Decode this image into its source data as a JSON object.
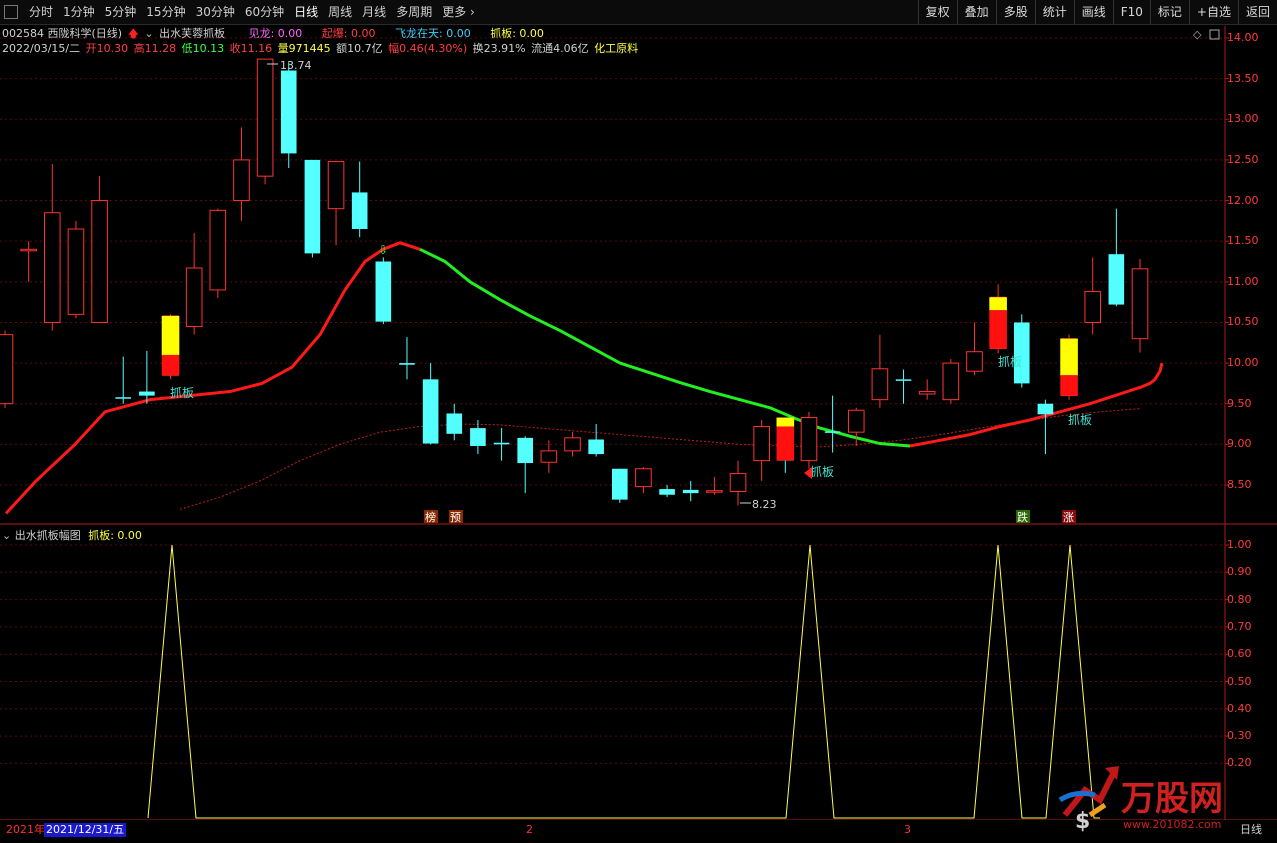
{
  "toolbar": {
    "periods": [
      "分时",
      "1分钟",
      "5分钟",
      "15分钟",
      "30分钟",
      "60分钟",
      "日线",
      "周线",
      "月线",
      "多周期",
      "更多 ›"
    ],
    "active_period": "日线",
    "buttons": [
      "复权",
      "叠加",
      "多股",
      "统计",
      "画线",
      "F10",
      "标记",
      "+自选",
      "返回"
    ]
  },
  "stock": {
    "code_name": "002584 西陇科学(日线)",
    "indicator_name": "出水芙蓉抓板",
    "jianlong": "见龙: 0.00",
    "qibao": "起爆: 0.00",
    "feilong": "飞龙在天: 0.00",
    "zhuaban": "抓板: 0.00"
  },
  "quote": {
    "date": "2022/03/15/二",
    "open": "开10.30",
    "high": "高11.28",
    "low": "低10.13",
    "close": "收11.16",
    "volume": "量971445",
    "amount": "额10.7亿",
    "change": "幅0.46(4.30%)",
    "turnover": "换23.91%",
    "float": "流通4.06亿",
    "sector": "化工原料"
  },
  "sub_panel": {
    "title": "出水抓板幅图",
    "value": "抓板: 0.00"
  },
  "main_axis": [
    "14.00",
    "13.50",
    "13.00",
    "12.50",
    "12.00",
    "11.50",
    "11.00",
    "10.50",
    "10.00",
    "9.50",
    "9.00",
    "8.50"
  ],
  "sub_axis": [
    "1.00",
    "0.90",
    "0.80",
    "0.70",
    "0.60",
    "0.50",
    "0.40",
    "0.30",
    "0.20"
  ],
  "annotations": {
    "high_label": "13.74",
    "low_label": "8.23",
    "signal": "抓板",
    "bang": "榜",
    "yu": "预",
    "die": "跌",
    "zhang": "涨"
  },
  "timeline": {
    "year": "2021年",
    "date_cursor": "2021/12/31/五",
    "month2": "2",
    "month3": "3",
    "right_label": "日线"
  },
  "logo": {
    "text": "万股网",
    "url": "www.201082.com"
  },
  "chart_data": {
    "type": "candlestick",
    "ylim": [
      8.1,
      14.1
    ],
    "candles": [
      {
        "o": 9.5,
        "c": 10.35,
        "h": 10.4,
        "l": 9.45
      },
      {
        "o": 11.4,
        "c": 11.4,
        "h": 11.5,
        "l": 11.0
      },
      {
        "o": 10.5,
        "c": 11.85,
        "h": 12.45,
        "l": 10.4
      },
      {
        "o": 10.6,
        "c": 11.65,
        "h": 11.75,
        "l": 10.55
      },
      {
        "o": 10.5,
        "c": 12.0,
        "h": 12.3,
        "l": 10.5
      },
      {
        "o": 9.58,
        "c": 9.57,
        "h": 10.08,
        "l": 9.5
      },
      {
        "o": 9.65,
        "c": 9.6,
        "h": 10.15,
        "l": 9.5
      },
      {
        "o": 9.85,
        "c": 10.58,
        "h": 10.6,
        "l": 9.8
      },
      {
        "o": 10.45,
        "c": 11.17,
        "h": 11.6,
        "l": 10.35
      },
      {
        "o": 10.9,
        "c": 11.88,
        "h": 11.9,
        "l": 10.8
      },
      {
        "o": 12.0,
        "c": 12.5,
        "h": 12.9,
        "l": 11.75
      },
      {
        "o": 12.3,
        "c": 13.74,
        "h": 13.74,
        "l": 12.2
      },
      {
        "o": 13.6,
        "c": 12.58,
        "h": 13.7,
        "l": 12.4
      },
      {
        "o": 12.5,
        "c": 11.35,
        "h": 12.5,
        "l": 11.3
      },
      {
        "o": 11.9,
        "c": 12.48,
        "h": 12.48,
        "l": 11.45
      },
      {
        "o": 12.1,
        "c": 11.65,
        "h": 12.48,
        "l": 11.55
      },
      {
        "o": 11.25,
        "c": 10.51,
        "h": 11.3,
        "l": 10.48
      },
      {
        "o": 10.0,
        "c": 9.98,
        "h": 10.32,
        "l": 9.8
      },
      {
        "o": 9.8,
        "c": 9.01,
        "h": 10.0,
        "l": 9.0
      },
      {
        "o": 9.38,
        "c": 9.13,
        "h": 9.5,
        "l": 9.05
      },
      {
        "o": 9.2,
        "c": 8.98,
        "h": 9.3,
        "l": 8.88
      },
      {
        "o": 9.02,
        "c": 9.0,
        "h": 9.2,
        "l": 8.8
      },
      {
        "o": 9.08,
        "c": 8.77,
        "h": 9.1,
        "l": 8.4
      },
      {
        "o": 8.78,
        "c": 8.92,
        "h": 9.05,
        "l": 8.65
      },
      {
        "o": 8.92,
        "c": 9.08,
        "h": 9.15,
        "l": 8.85
      },
      {
        "o": 9.06,
        "c": 8.88,
        "h": 9.25,
        "l": 8.85
      },
      {
        "o": 8.7,
        "c": 8.32,
        "h": 8.7,
        "l": 8.28
      },
      {
        "o": 8.48,
        "c": 8.7,
        "h": 8.72,
        "l": 8.4
      },
      {
        "o": 8.45,
        "c": 8.38,
        "h": 8.5,
        "l": 8.35
      },
      {
        "o": 8.44,
        "c": 8.4,
        "h": 8.55,
        "l": 8.3
      },
      {
        "o": 8.42,
        "c": 8.43,
        "h": 8.6,
        "l": 8.38
      },
      {
        "o": 8.42,
        "c": 8.64,
        "h": 8.8,
        "l": 8.25
      },
      {
        "o": 8.8,
        "c": 9.22,
        "h": 9.3,
        "l": 8.55
      },
      {
        "o": 8.95,
        "c": 8.8,
        "h": 9.0,
        "l": 8.65
      },
      {
        "o": 8.8,
        "c": 9.33,
        "h": 9.4,
        "l": 8.7
      },
      {
        "o": 9.16,
        "c": 9.15,
        "h": 9.6,
        "l": 8.9
      },
      {
        "o": 9.15,
        "c": 9.42,
        "h": 9.45,
        "l": 8.98
      },
      {
        "o": 9.55,
        "c": 9.93,
        "h": 10.35,
        "l": 9.45
      },
      {
        "o": 9.8,
        "c": 9.79,
        "h": 9.92,
        "l": 9.5
      },
      {
        "o": 9.62,
        "c": 9.65,
        "h": 9.8,
        "l": 9.55
      },
      {
        "o": 9.55,
        "c": 10.0,
        "h": 10.05,
        "l": 9.5
      },
      {
        "o": 9.9,
        "c": 10.14,
        "h": 10.5,
        "l": 9.85
      },
      {
        "o": 10.18,
        "c": 10.81,
        "h": 10.97,
        "l": 10.12
      },
      {
        "o": 10.5,
        "c": 9.75,
        "h": 10.6,
        "l": 9.7
      },
      {
        "o": 9.5,
        "c": 9.37,
        "h": 9.55,
        "l": 8.88
      },
      {
        "o": 9.6,
        "c": 10.3,
        "h": 10.35,
        "l": 9.55
      },
      {
        "o": 10.5,
        "c": 10.88,
        "h": 11.3,
        "l": 10.35
      },
      {
        "o": 11.34,
        "c": 10.72,
        "h": 11.9,
        "l": 10.7
      },
      {
        "o": 10.3,
        "c": 11.16,
        "h": 11.28,
        "l": 10.13
      }
    ],
    "signal_bars": [
      {
        "index": 7,
        "top": 10.58,
        "mid": 10.1,
        "bottom": 9.85
      },
      {
        "index": 33,
        "top": 9.33,
        "mid": 9.22,
        "bottom": 8.8
      },
      {
        "index": 42,
        "top": 10.81,
        "mid": 10.65,
        "bottom": 10.18
      },
      {
        "index": 45,
        "top": 10.3,
        "mid": 9.85,
        "bottom": 9.6
      }
    ],
    "ma_fast": [
      8.15,
      8.55,
      9.0,
      9.4,
      9.55,
      9.6,
      9.65,
      9.75,
      9.95,
      10.35,
      10.9,
      11.25,
      11.4,
      11.48,
      11.4,
      11.25,
      11.0,
      10.78,
      10.58,
      10.4,
      10.2,
      10.0,
      9.88,
      9.76,
      9.65,
      9.55,
      9.45,
      9.32,
      9.2,
      9.1,
      9.01,
      8.98,
      9.05,
      9.12,
      9.22,
      9.3,
      9.4,
      9.5,
      9.62,
      9.7,
      9.75,
      9.8,
      9.9,
      10.0
    ],
    "ma_fast_x": [
      6,
      36,
      75,
      105,
      150,
      190,
      230,
      262,
      292,
      320,
      345,
      365,
      383,
      400,
      420,
      445,
      470,
      500,
      530,
      560,
      590,
      620,
      650,
      680,
      710,
      740,
      770,
      795,
      820,
      850,
      880,
      910,
      940,
      970,
      1000,
      1030,
      1060,
      1090,
      1120,
      1140,
      1150,
      1155,
      1160,
      1162
    ],
    "ma_slow": [
      8.2,
      8.35,
      8.55,
      8.8,
      9.0,
      9.15,
      9.22,
      9.25,
      9.24,
      9.2,
      9.16,
      9.12,
      9.08,
      9.04,
      9.0,
      8.98,
      8.97,
      9.0,
      9.05,
      9.12,
      9.2,
      9.28,
      9.35,
      9.4,
      9.44
    ],
    "ma_slow_x": [
      180,
      220,
      260,
      300,
      340,
      380,
      420,
      460,
      500,
      540,
      580,
      620,
      660,
      700,
      740,
      780,
      820,
      860,
      900,
      940,
      980,
      1020,
      1060,
      1100,
      1140
    ],
    "sub_spikes": [
      172,
      810,
      998,
      1070
    ],
    "sub_ylim": [
      0.0,
      1.05
    ]
  }
}
